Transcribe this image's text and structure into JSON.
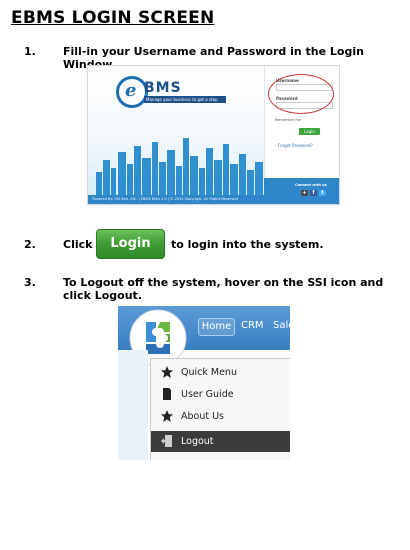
{
  "title": "EBMS LOGIN SCREEN",
  "steps": [
    {
      "num": "1.",
      "text": "Fill-in your Username and Password in the Login Window."
    },
    {
      "num": "2.",
      "text_before": "Click",
      "text_after": "to login into the system."
    },
    {
      "num": "3.",
      "text_line1": "To Logout off the system, hover on the SSI icon and",
      "text_line2": "click Logout."
    }
  ],
  "login_window": {
    "logo_letter": "e",
    "brand": "BMS",
    "tagline": "Manage your business to get a step",
    "username_label": "Username",
    "password_label": "Password",
    "remember_label": "Remember me",
    "login_button": "Login",
    "forgot_link": "Forgot Password?",
    "connect_label": "Connect with us",
    "footer": "Powered By: SSI Soft, INC. | EBMS Beta 1.0 | © 2012 Copyright. All Rights Reserved",
    "social": [
      "+",
      "f",
      "t"
    ]
  },
  "login_button_label": "Login",
  "menu_window": {
    "tabs": [
      "Home",
      "CRM",
      "Sale"
    ],
    "items": [
      "Quick Menu",
      "User Guide",
      "About Us",
      "Logout"
    ],
    "active_item": "Logout"
  },
  "colors": {
    "brand_blue": "#1e4f8a",
    "login_green": "#3e9b35",
    "menu_bar_blue": "#3a7ec2",
    "highlight_dark": "#3c3c3c",
    "annotation_red": "#c83838"
  }
}
